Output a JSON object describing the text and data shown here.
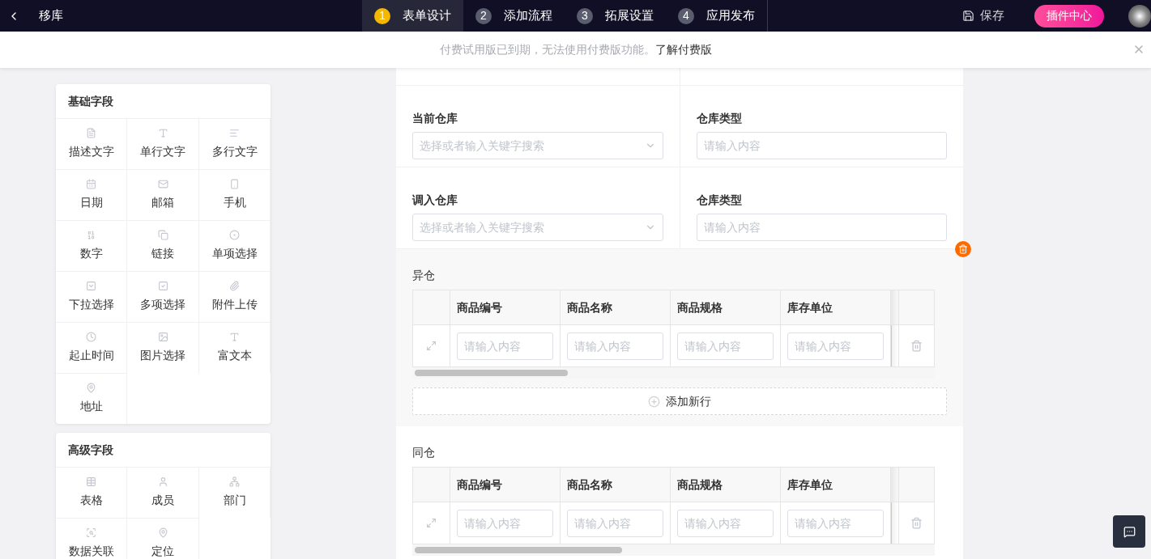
{
  "app_bar": {
    "title": "移库",
    "save": "保存",
    "plugin_button": "插件中心",
    "steps": [
      {
        "number": "1",
        "label": "表单设计",
        "selected": true
      },
      {
        "number": "2",
        "label": "添加流程",
        "selected": false
      },
      {
        "number": "3",
        "label": "拓展设置",
        "selected": false
      },
      {
        "number": "4",
        "label": "应用发布",
        "selected": false
      }
    ]
  },
  "notice": {
    "text": "付费试用版已到期，无法使用付费版功能。",
    "link": "了解付费版"
  },
  "palette": [
    {
      "title": "基础字段",
      "fields": [
        "描述文字",
        "单行文字",
        "多行文字",
        "日期",
        "邮箱",
        "手机",
        "数字",
        "链接",
        "单项选择",
        "下拉选择",
        "多项选择",
        "附件上传",
        "起止时间",
        "图片选择",
        "富文本",
        "地址"
      ]
    },
    {
      "title": "高级字段",
      "fields": [
        "表格",
        "成员",
        "部门",
        "数据关联",
        "定位"
      ]
    }
  ],
  "form": {
    "rows": [
      {
        "fields": [
          {
            "label": "当前仓库",
            "placeholder": "选择或者输入关键字搜索",
            "kind": "select"
          },
          {
            "label": "仓库类型",
            "placeholder": "请输入内容",
            "kind": "text"
          }
        ]
      },
      {
        "fields": [
          {
            "label": "调入仓库",
            "placeholder": "选择或者输入关键字搜索",
            "kind": "select"
          },
          {
            "label": "仓库类型",
            "placeholder": "请输入内容",
            "kind": "text"
          }
        ]
      }
    ],
    "subtables": [
      {
        "title": "异仓",
        "selected": true,
        "columns": [
          "商品编号",
          "商品名称",
          "商品规格",
          "库存单位"
        ],
        "placeholders": [
          "请输入内容",
          "请输入内容",
          "请输入内容",
          "请输入内容"
        ],
        "add_row": "添加新行"
      },
      {
        "title": "同仓",
        "selected": false,
        "columns": [
          "商品编号",
          "商品名称",
          "商品规格",
          "库存单位"
        ],
        "placeholders": [
          "请输入内容",
          "请输入内容",
          "请输入内容",
          "请输入内容"
        ]
      }
    ]
  }
}
